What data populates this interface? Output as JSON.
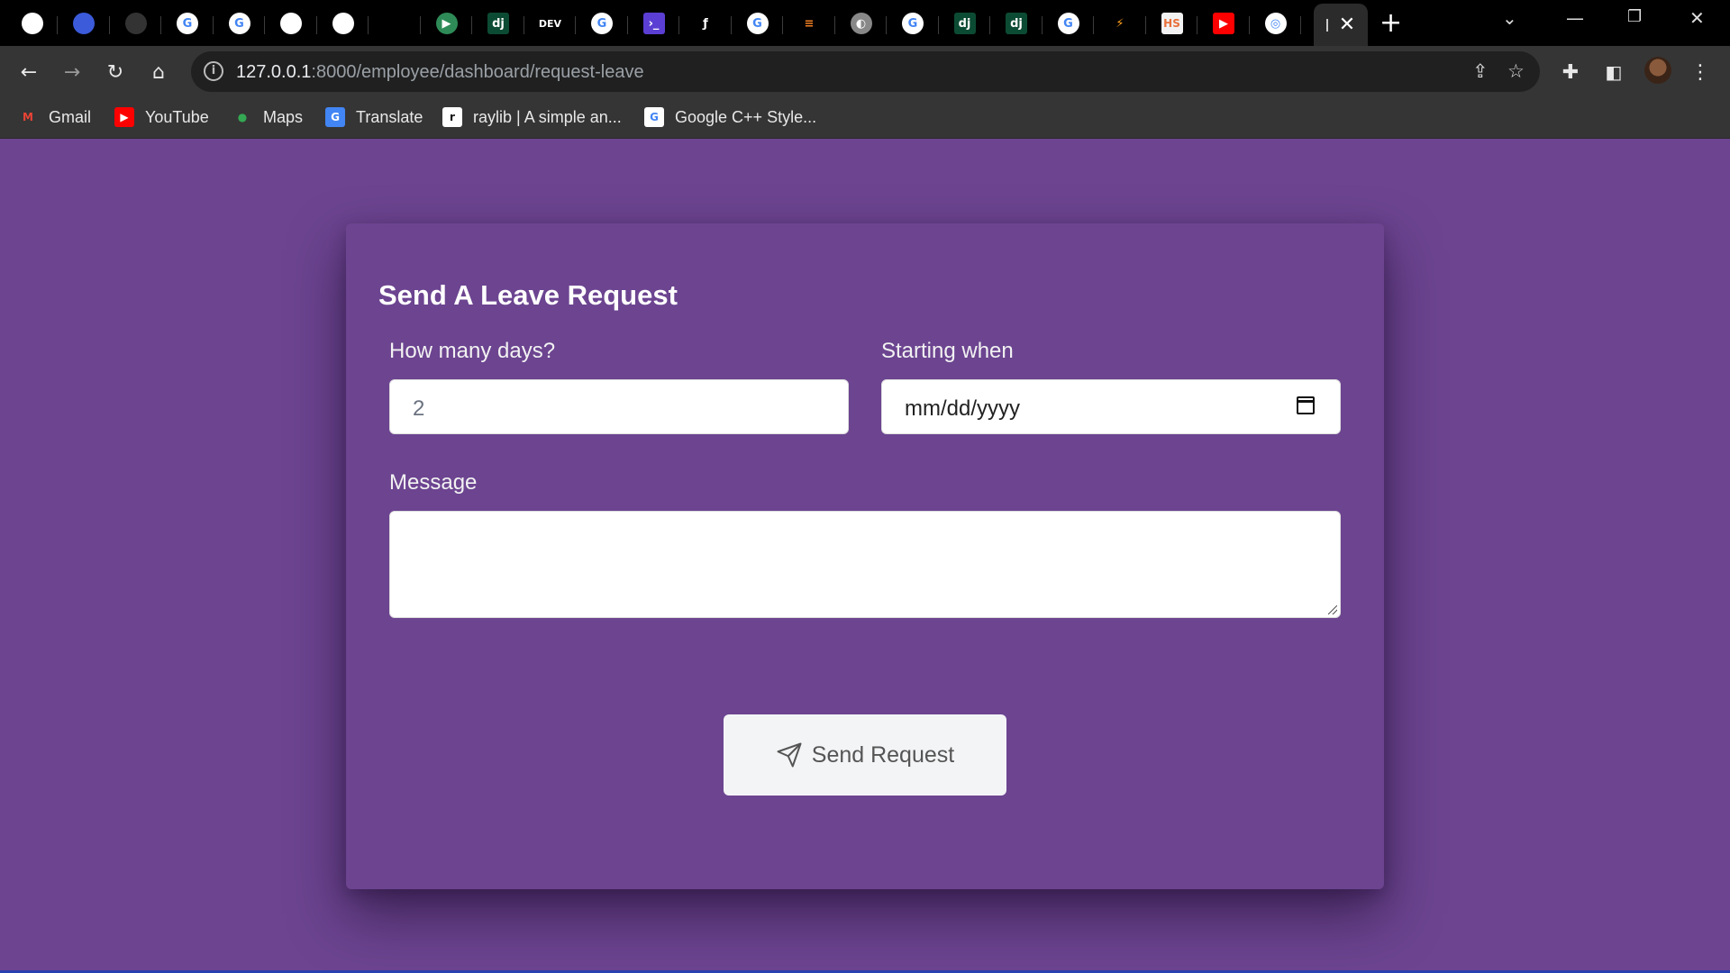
{
  "browser": {
    "tabs": [
      {
        "icon": "github-icon",
        "glyph": "",
        "bg": "#ffffff"
      },
      {
        "icon": "cloud-app-icon",
        "glyph": "",
        "bg": "#3b5bdb"
      },
      {
        "icon": "dark-circle-icon",
        "glyph": "",
        "bg": "#333333"
      },
      {
        "icon": "google-icon",
        "glyph": "G",
        "bg": "#ffffff"
      },
      {
        "icon": "google-icon",
        "glyph": "G",
        "bg": "#ffffff"
      },
      {
        "icon": "pen-circle-icon",
        "glyph": "",
        "bg": "#ffffff"
      },
      {
        "icon": "pen-circle-icon",
        "glyph": "",
        "bg": "#ffffff"
      },
      {
        "icon": "terminal-dots-icon",
        "glyph": "",
        "bg": "#000000"
      },
      {
        "icon": "play-circle-icon",
        "glyph": "▶",
        "bg": "#2e8b57"
      },
      {
        "icon": "django-icon",
        "glyph": "dj",
        "bg": "#0c4b33"
      },
      {
        "icon": "dev-icon",
        "glyph": "DEV",
        "bg": "#000000"
      },
      {
        "icon": "google-icon",
        "glyph": "G",
        "bg": "#ffffff"
      },
      {
        "icon": "terminal-icon",
        "glyph": "›_",
        "bg": "#5b3fd4"
      },
      {
        "icon": "blue-f-icon",
        "glyph": "ƒ",
        "bg": "#000000"
      },
      {
        "icon": "google-icon",
        "glyph": "G",
        "bg": "#ffffff"
      },
      {
        "icon": "stackoverflow-icon",
        "glyph": "≡",
        "bg": "#000000"
      },
      {
        "icon": "globe-icon",
        "glyph": "◐",
        "bg": "#888888"
      },
      {
        "icon": "google-icon",
        "glyph": "G",
        "bg": "#ffffff"
      },
      {
        "icon": "django-icon",
        "glyph": "dj",
        "bg": "#0c4b33"
      },
      {
        "icon": "django-icon",
        "glyph": "dj",
        "bg": "#0c4b33"
      },
      {
        "icon": "google-icon",
        "glyph": "G",
        "bg": "#ffffff"
      },
      {
        "icon": "lightning-icon",
        "glyph": "⚡",
        "bg": "#000000"
      },
      {
        "icon": "hs-icon",
        "glyph": "HS",
        "bg": "#f2f2f2"
      },
      {
        "icon": "youtube-icon",
        "glyph": "▶",
        "bg": "#ff0000"
      },
      {
        "icon": "chrome-icon",
        "glyph": "◎",
        "bg": "#ffffff"
      }
    ],
    "url_host": "127.0.0.1",
    "url_path": ":8000/employee/dashboard/request-leave",
    "bookmarks": [
      {
        "label": "Gmail",
        "icon": "gmail-icon",
        "glyph": "M",
        "color": "#ea4335",
        "bg": "transparent"
      },
      {
        "label": "YouTube",
        "icon": "youtube-icon",
        "glyph": "▶",
        "color": "#ffffff",
        "bg": "#ff0000"
      },
      {
        "label": "Maps",
        "icon": "maps-pin-icon",
        "glyph": "●",
        "color": "#34a853",
        "bg": "transparent"
      },
      {
        "label": "Translate",
        "icon": "translate-icon",
        "glyph": "G",
        "color": "#ffffff",
        "bg": "#4285f4"
      },
      {
        "label": "raylib | A simple an...",
        "icon": "raylib-icon",
        "glyph": "r",
        "color": "#111111",
        "bg": "#ffffff"
      },
      {
        "label": "Google C++ Style...",
        "icon": "google-icon",
        "glyph": "G",
        "color": "#4285f4",
        "bg": "#ffffff"
      }
    ]
  },
  "form": {
    "title": "Send A Leave Request",
    "days_label": "How many days?",
    "days_value": "2",
    "start_label": "Starting when",
    "start_placeholder": "mm/dd/yyyy",
    "message_label": "Message",
    "message_value": "",
    "submit_label": "Send Request"
  },
  "colors": {
    "page_bg": "#6c4490",
    "button_bg": "#f3f4f6"
  }
}
